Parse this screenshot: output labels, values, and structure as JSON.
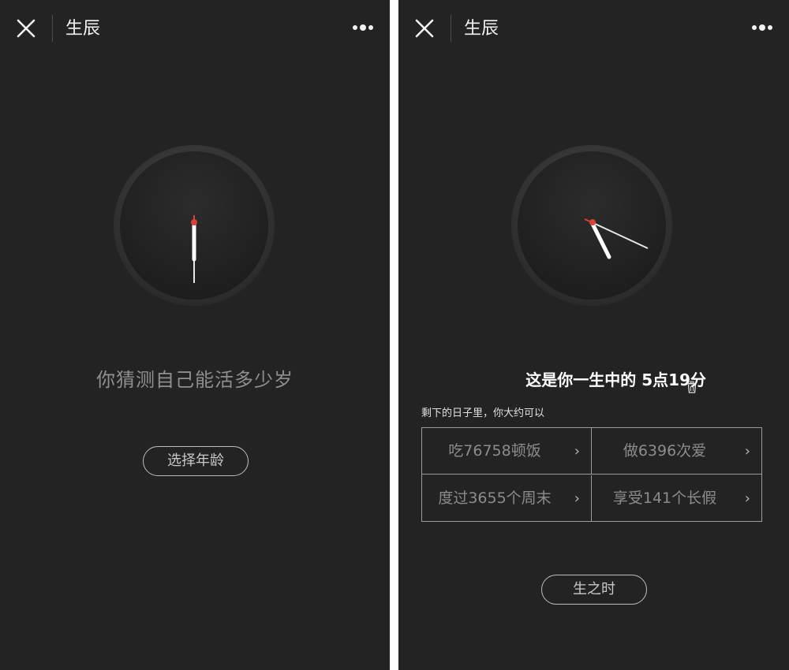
{
  "screen1": {
    "header": {
      "title": "生辰",
      "close_icon": "close-icon",
      "more_icon": "more-icon"
    },
    "question": "你猜测自己能活多少岁",
    "button_label": "选择年龄",
    "clock": {
      "time_shown": "6:00"
    }
  },
  "screen2": {
    "header": {
      "title": "生辰",
      "close_icon": "close-icon",
      "more_icon": "more-icon"
    },
    "result": "这是你一生中的 5点19分",
    "clock": {
      "time_shown": "5:19"
    },
    "subheading": "剩下的日子里，你大约可以",
    "grid": [
      {
        "label": "吃76758顿饭"
      },
      {
        "label": "做6396次爱"
      },
      {
        "label": "度过3655个周末"
      },
      {
        "label": "享受141个长假"
      }
    ],
    "chevron": "›",
    "button_label": "生之时"
  },
  "colors": {
    "background": "#232324",
    "accent_dot": "#d9413a",
    "text": "#f2f2f2"
  }
}
